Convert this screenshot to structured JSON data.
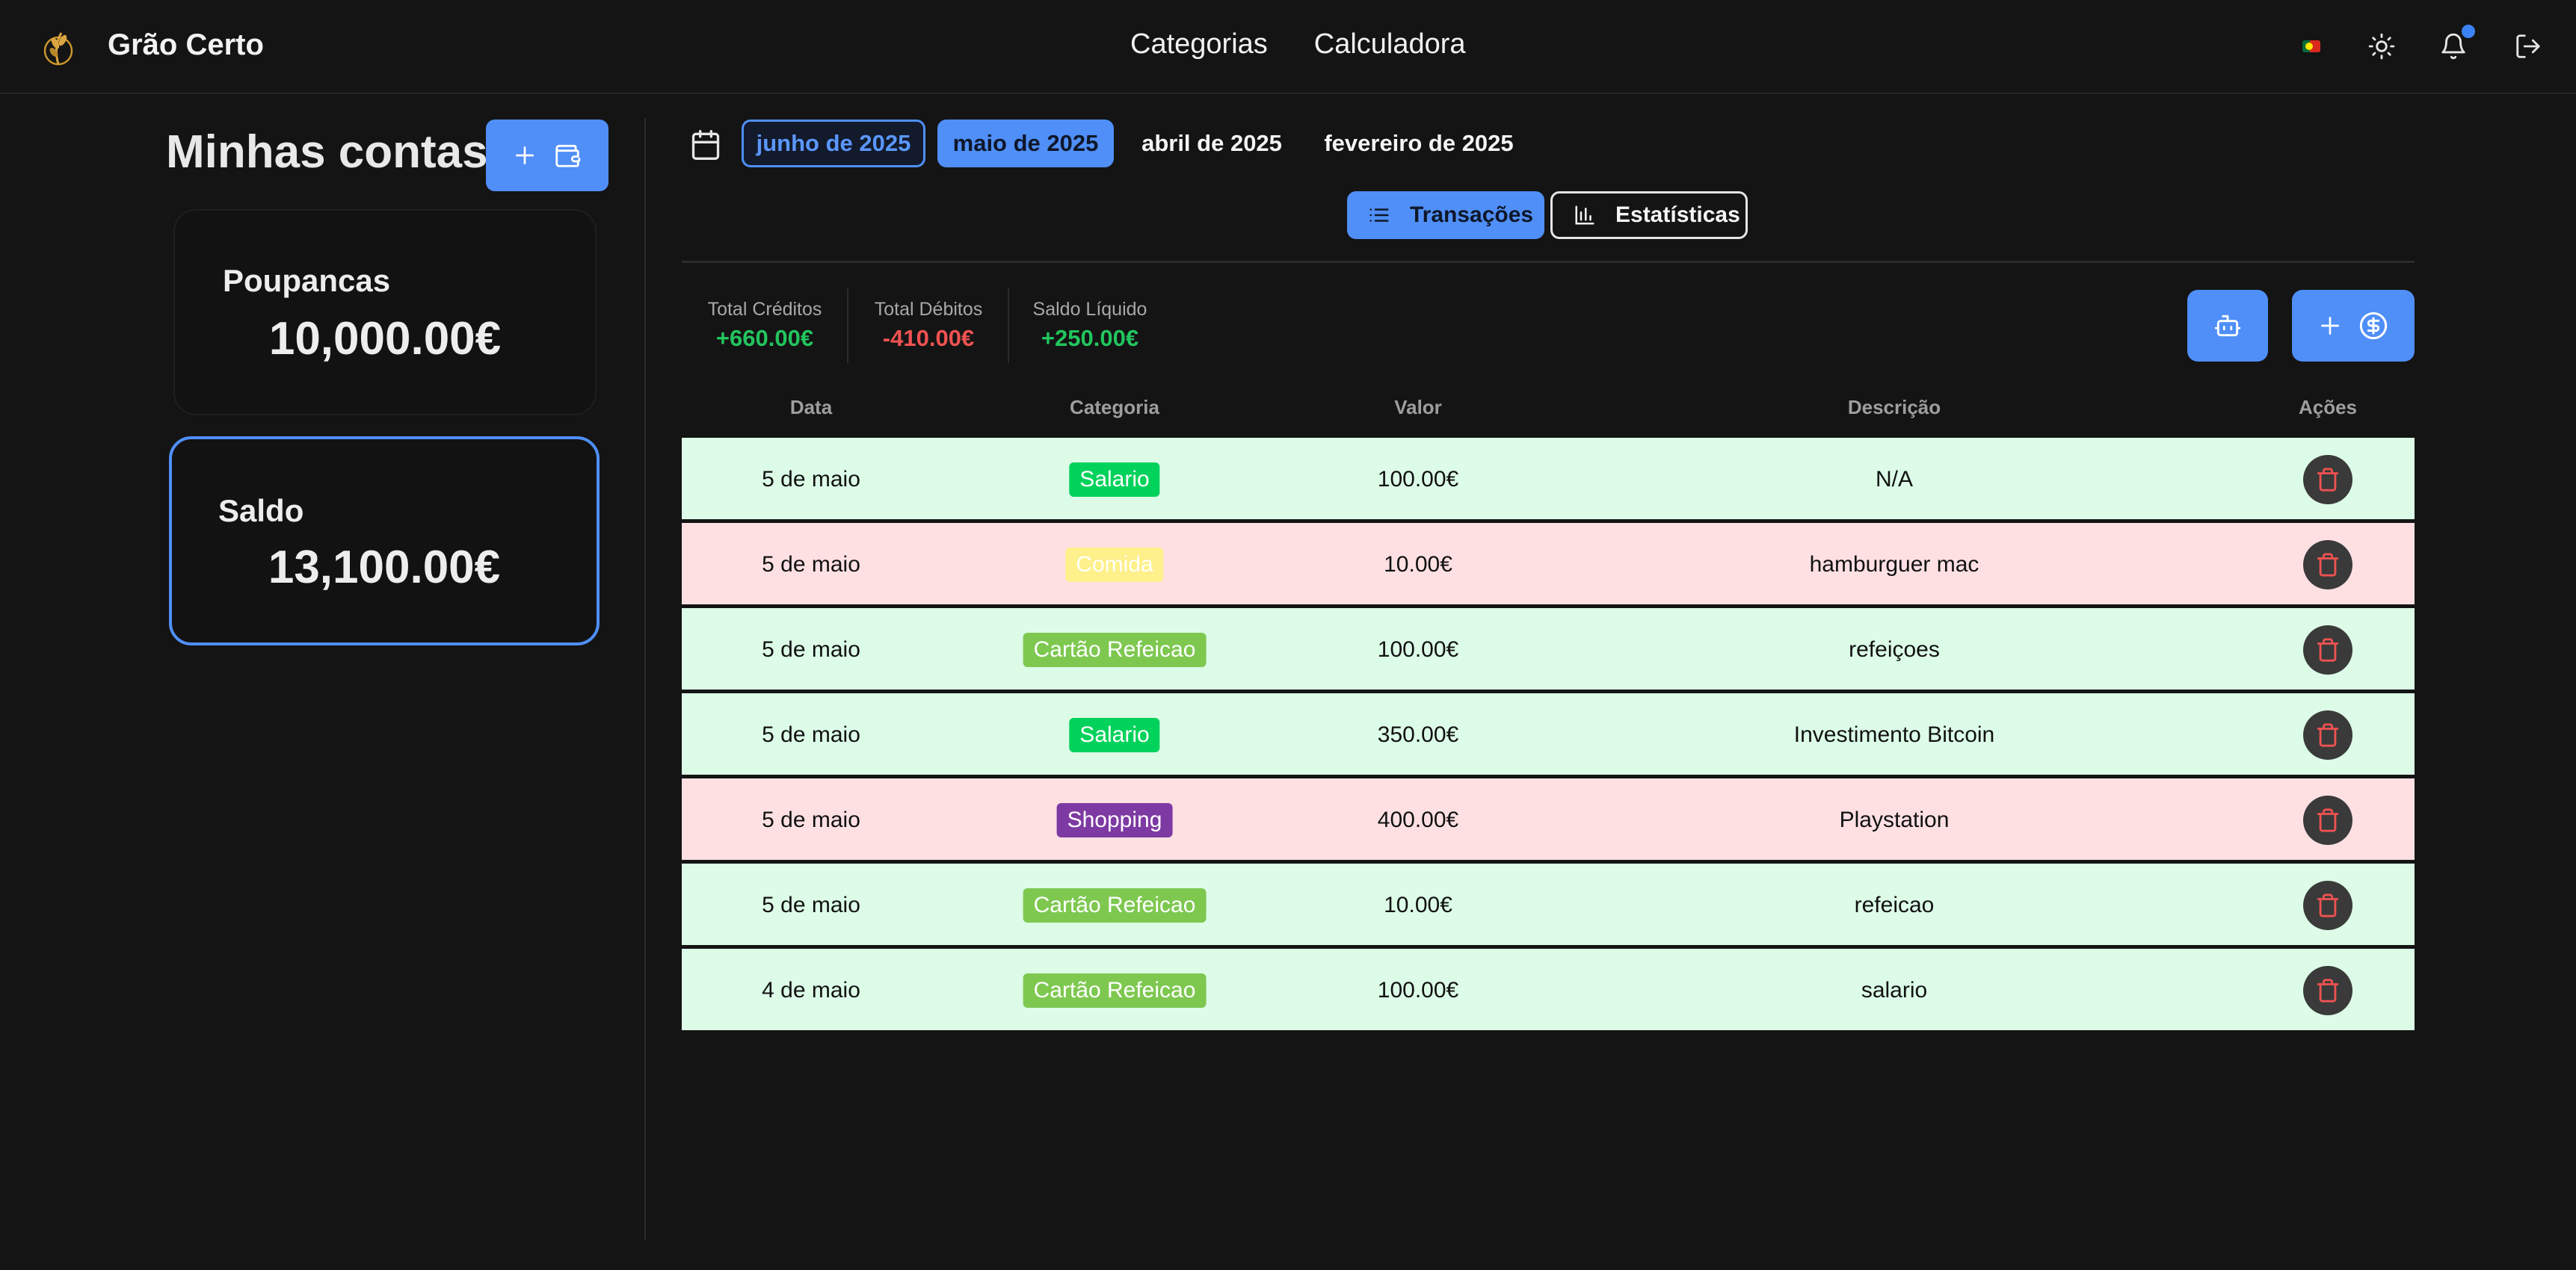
{
  "header": {
    "app_name": "Grão Certo",
    "nav": [
      "Categorias",
      "Calculadora"
    ],
    "icons": [
      "language-flag-icon",
      "sun-icon",
      "bell-icon",
      "logout-icon"
    ]
  },
  "sidebar": {
    "title": "Minhas contas",
    "accounts": [
      {
        "name": "Poupancas",
        "balance": "10,000.00€",
        "active": false
      },
      {
        "name": "Saldo",
        "balance": "13,100.00€",
        "active": true
      }
    ]
  },
  "months": [
    {
      "label": "junho de 2025",
      "state": "outlined"
    },
    {
      "label": "maio de 2025",
      "state": "selected"
    },
    {
      "label": "abril de 2025",
      "state": "plain"
    },
    {
      "label": "fevereiro de 2025",
      "state": "plain"
    }
  ],
  "views": [
    {
      "label": "Transações",
      "active": true
    },
    {
      "label": "Estatísticas",
      "active": false
    }
  ],
  "totals": [
    {
      "label": "Total Créditos",
      "value": "+660.00€",
      "color": "#22c55e"
    },
    {
      "label": "Total Débitos",
      "value": "-410.00€",
      "color": "#f05252"
    },
    {
      "label": "Saldo Líquido",
      "value": "+250.00€",
      "color": "#22c55e"
    }
  ],
  "table": {
    "headers": [
      "Data",
      "Categoria",
      "Valor",
      "Descrição",
      "Ações"
    ],
    "rows": [
      {
        "date": "5 de maio",
        "category": "Salario",
        "cat_bg": "#00d25b",
        "cat_fg": "#ffffff",
        "value": "100.00€",
        "description": "N/A",
        "type": "credit"
      },
      {
        "date": "5 de maio",
        "category": "Comida",
        "cat_bg": "#fef08a",
        "cat_fg": "#ffffff",
        "value": "10.00€",
        "description": "hamburguer mac",
        "type": "debit"
      },
      {
        "date": "5 de maio",
        "category": "Cartão Refeicao",
        "cat_bg": "#7ec850",
        "cat_fg": "#ffffff",
        "value": "100.00€",
        "description": "refeiçoes",
        "type": "credit"
      },
      {
        "date": "5 de maio",
        "category": "Salario",
        "cat_bg": "#00d25b",
        "cat_fg": "#ffffff",
        "value": "350.00€",
        "description": "Investimento Bitcoin",
        "type": "credit"
      },
      {
        "date": "5 de maio",
        "category": "Shopping",
        "cat_bg": "#7e3aa3",
        "cat_fg": "#ffffff",
        "value": "400.00€",
        "description": "Playstation",
        "type": "debit"
      },
      {
        "date": "5 de maio",
        "category": "Cartão Refeicao",
        "cat_bg": "#7ec850",
        "cat_fg": "#ffffff",
        "value": "10.00€",
        "description": "refeicao",
        "type": "credit"
      },
      {
        "date": "4 de maio",
        "category": "Cartão Refeicao",
        "cat_bg": "#7ec850",
        "cat_fg": "#ffffff",
        "value": "100.00€",
        "description": "salario",
        "type": "credit"
      }
    ]
  },
  "colors": {
    "accent": "#4f8ff7",
    "credit_row": "#dcfce7",
    "debit_row": "#fee0e3",
    "delete_icon": "#f05252"
  }
}
